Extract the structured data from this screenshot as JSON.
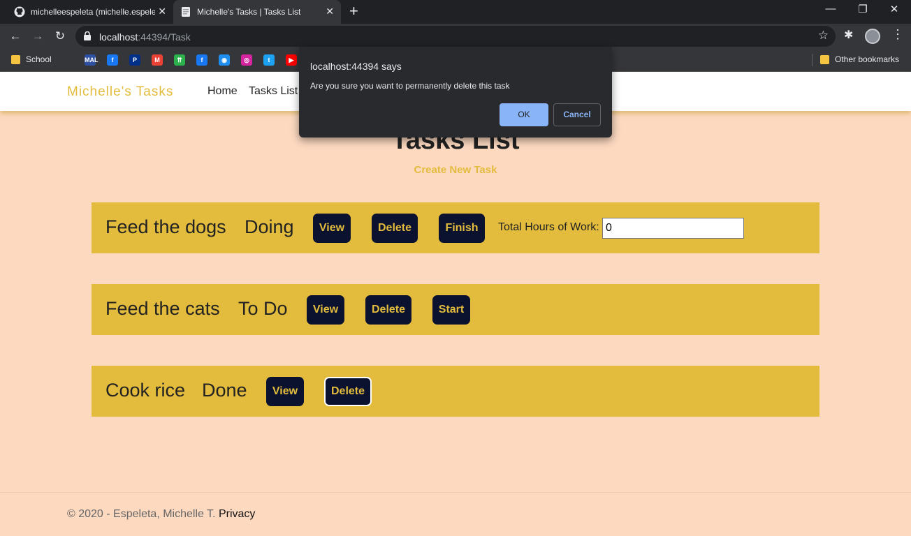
{
  "browser": {
    "tabs": [
      {
        "title": "michelleespeleta (michelle.espeleta",
        "close": "✕"
      },
      {
        "title": "Michelle's Tasks | Tasks List",
        "close": "✕"
      }
    ],
    "new_tab": "+",
    "window_controls": {
      "minimize": "—",
      "restore": "❐",
      "close": "✕"
    },
    "nav": {
      "back": "←",
      "forward": "→",
      "reload": "↻"
    },
    "url": {
      "host": "localhost",
      "rest": ":44394/Task"
    },
    "bookmarks": {
      "school": "School",
      "other": "Other bookmarks",
      "icons": [
        {
          "name": "mal-icon",
          "glyph": "MAL",
          "color": "#2e51a2"
        },
        {
          "name": "facebook-icon",
          "glyph": "f",
          "color": "#1877f2"
        },
        {
          "name": "paypal-icon",
          "glyph": "P",
          "color": "#003087"
        },
        {
          "name": "gmail-icon",
          "glyph": "M",
          "color": "#ea4335"
        },
        {
          "name": "feedly-icon",
          "glyph": "⇈",
          "color": "#2bb24c"
        },
        {
          "name": "facebook-icon-2",
          "glyph": "f",
          "color": "#1877f2"
        },
        {
          "name": "messenger-icon",
          "glyph": "◉",
          "color": "#1f8ef1"
        },
        {
          "name": "instagram-icon",
          "glyph": "◎",
          "color": "#d6249f"
        },
        {
          "name": "twitter-icon",
          "glyph": "t",
          "color": "#1da1f2"
        },
        {
          "name": "youtube-icon",
          "glyph": "▶",
          "color": "#ff0000"
        }
      ]
    }
  },
  "navbar": {
    "brand": "Michelle's Tasks",
    "links": [
      "Home",
      "Tasks List"
    ]
  },
  "page": {
    "title": "Tasks List",
    "create_link": "Create New Task"
  },
  "tasks": [
    {
      "name": "Feed the dogs",
      "status": "Doing",
      "buttons": [
        "View",
        "Delete",
        "Finish"
      ],
      "hours_label": "Total Hours of Work:",
      "hours_value": "0"
    },
    {
      "name": "Feed the cats",
      "status": "To Do",
      "buttons": [
        "View",
        "Delete",
        "Start"
      ]
    },
    {
      "name": "Cook rice",
      "status": "Done",
      "buttons": [
        "View",
        "Delete"
      ]
    }
  ],
  "footer": {
    "copyright": "© 2020 - Espeleta, Michelle T.",
    "privacy": "Privacy"
  },
  "dialog": {
    "title": "localhost:44394 says",
    "message": "Are you sure you want to permanently delete this task",
    "ok": "OK",
    "cancel": "Cancel"
  },
  "colors": {
    "page_bg": "#fdd9c0",
    "accent": "#e3bc3d",
    "button_bg": "#0a1230"
  }
}
